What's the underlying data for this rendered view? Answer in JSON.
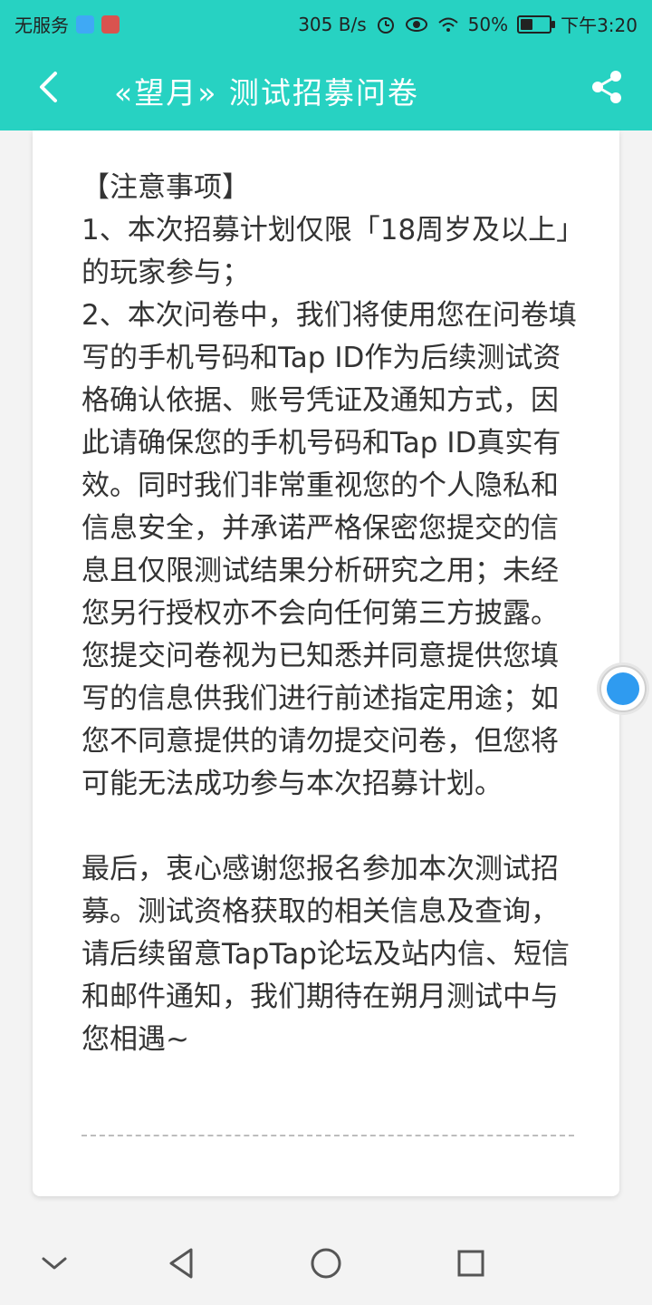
{
  "status_bar": {
    "carrier": "无服务",
    "speed": "305 B/s",
    "battery": "50%",
    "battery_level": 0.5,
    "time": "下午3:20",
    "icons": [
      "sync-icon",
      "app-icon",
      "alarm-icon",
      "eye-icon",
      "wifi-icon",
      "battery-icon"
    ]
  },
  "header": {
    "title": "«望月» 测试招募问卷",
    "back_icon": "back-arrow-icon",
    "share_icon": "share-icon",
    "background_color": "#27d2c2"
  },
  "content": {
    "paragraphs": [
      "【注意事项】",
      "1、本次招募计划仅限「18周岁及以上」的玩家参与；",
      "2、本次问卷中，我们将使用您在问卷填写的手机号码和Tap ID作为后续测试资格确认依据、账号凭证及通知方式，因此请确保您的手机号码和Tap ID真实有效。同时我们非常重视您的个人隐私和信息安全，并承诺严格保密您提交的信息且仅限测试结果分析研究之用；未经您另行授权亦不会向任何第三方披露。您提交问卷视为已知悉并同意提供您填写的信息供我们进行前述指定用途；如您不同意提供的请勿提交问卷，但您将可能无法成功参与本次招募计划。",
      "最后，衷心感谢您报名参加本次测试招募。测试资格获取的相关信息及查询，请后续留意TapTap论坛及站内信、短信和邮件通知，我们期待在朔月测试中与您相遇~"
    ]
  },
  "navigation": {
    "items": [
      "collapse-icon",
      "back-triangle-icon",
      "home-circle-icon",
      "recents-square-icon"
    ]
  }
}
